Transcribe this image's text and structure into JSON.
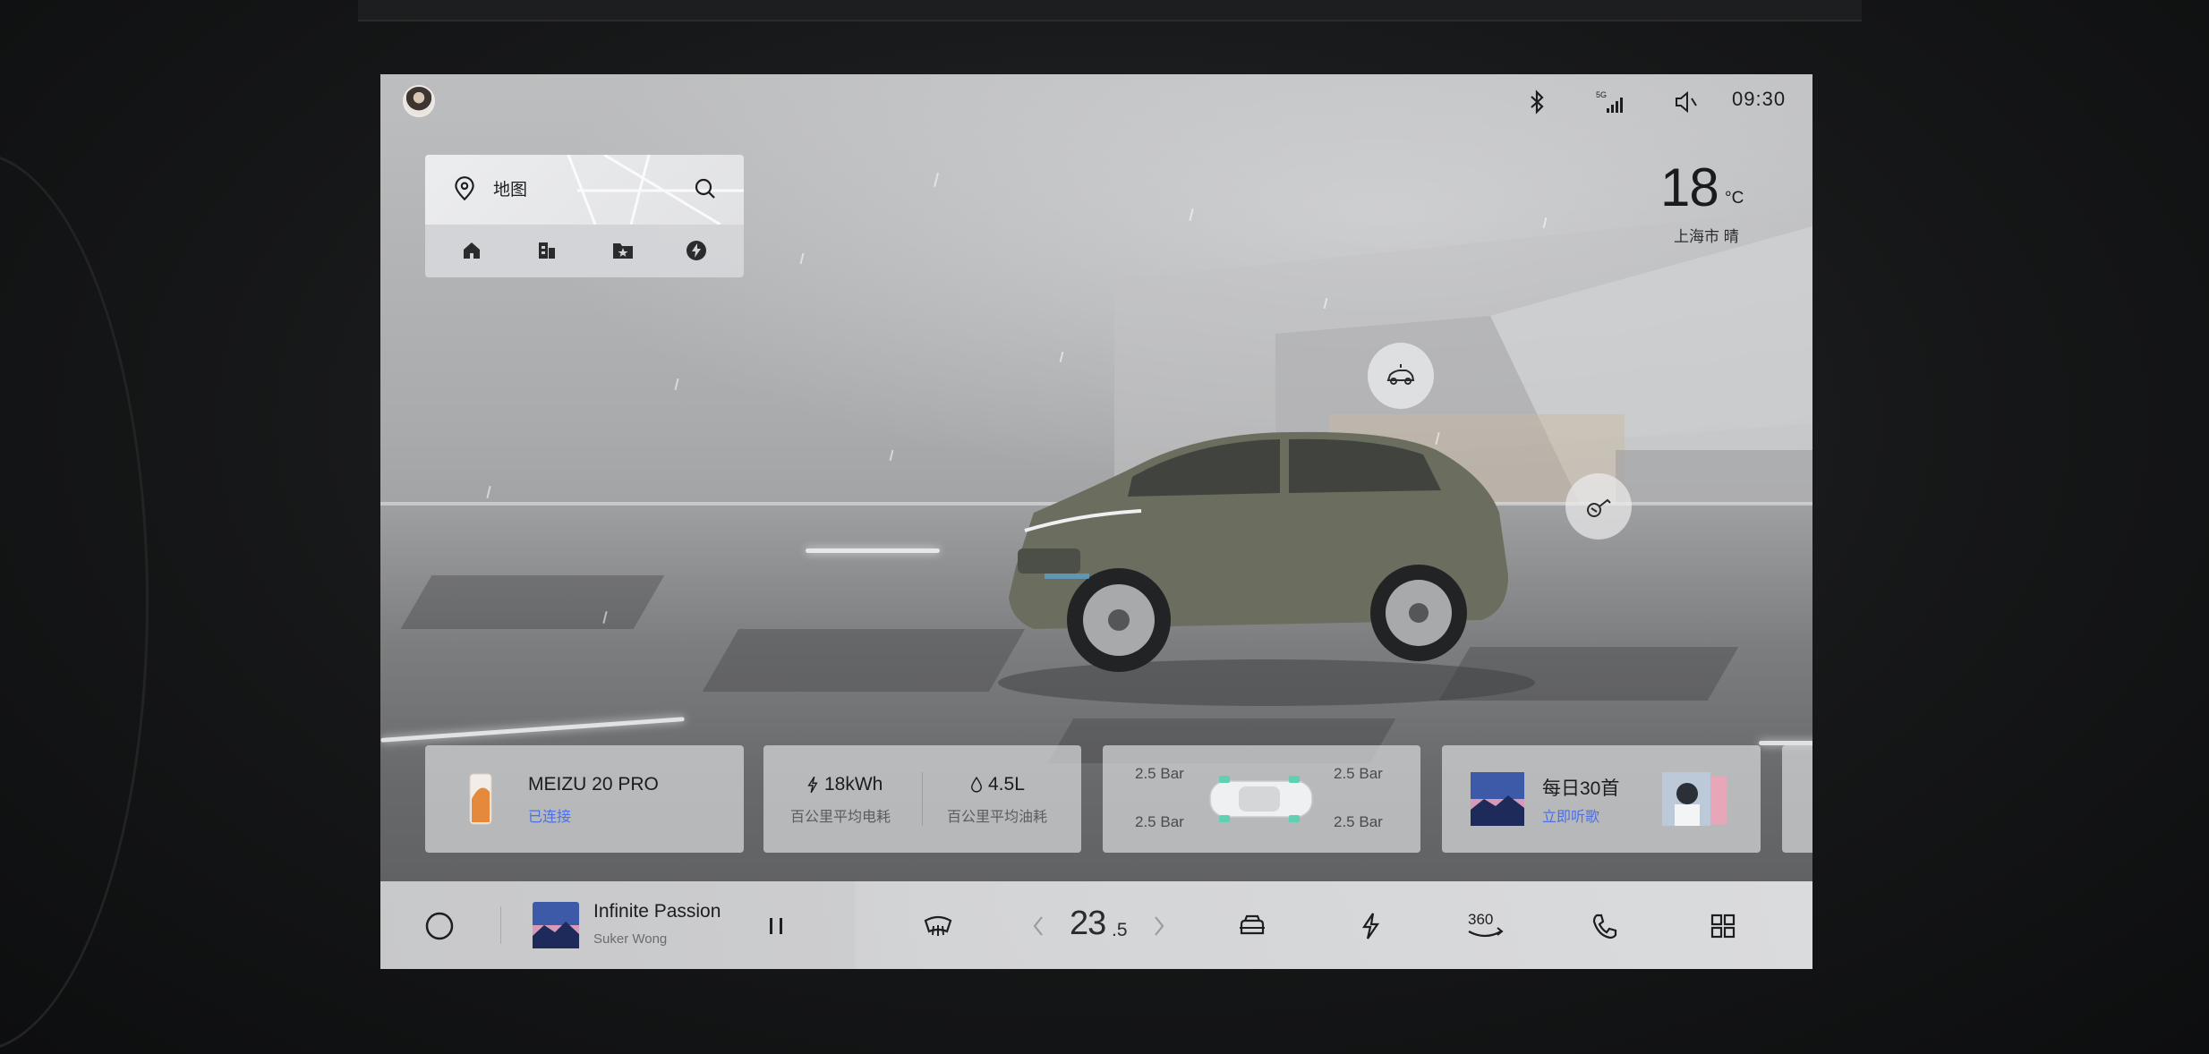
{
  "status": {
    "time": "09:30",
    "network": "5G"
  },
  "weather": {
    "temperature": "18",
    "unit": "°C",
    "location_condition": "上海市  晴"
  },
  "map": {
    "label": "地图",
    "shortcuts": [
      "home-icon",
      "office-icon",
      "favorite-icon",
      "charging-icon"
    ]
  },
  "cards": {
    "phone": {
      "title": "MEIZU 20 PRO",
      "subtitle": "已连接"
    },
    "energy": {
      "electric_value": "18kWh",
      "electric_label": "百公里平均电耗",
      "fuel_value": "4.5L",
      "fuel_label": "百公里平均油耗"
    },
    "tires": {
      "front_left": "2.5 Bar",
      "front_right": "2.5 Bar",
      "rear_left": "2.5 Bar",
      "rear_right": "2.5 Bar"
    },
    "music": {
      "title": "每日30首",
      "subtitle": "立即听歌"
    }
  },
  "dock": {
    "song_title": "Infinite Passion",
    "song_artist": "Suker Wong",
    "temperature_int": "23",
    "temperature_dec": ".5"
  },
  "colors": {
    "accent": "#4d6fe0",
    "screen_bg": "#b3b4b6",
    "dock_bg": "#d8d9db"
  }
}
